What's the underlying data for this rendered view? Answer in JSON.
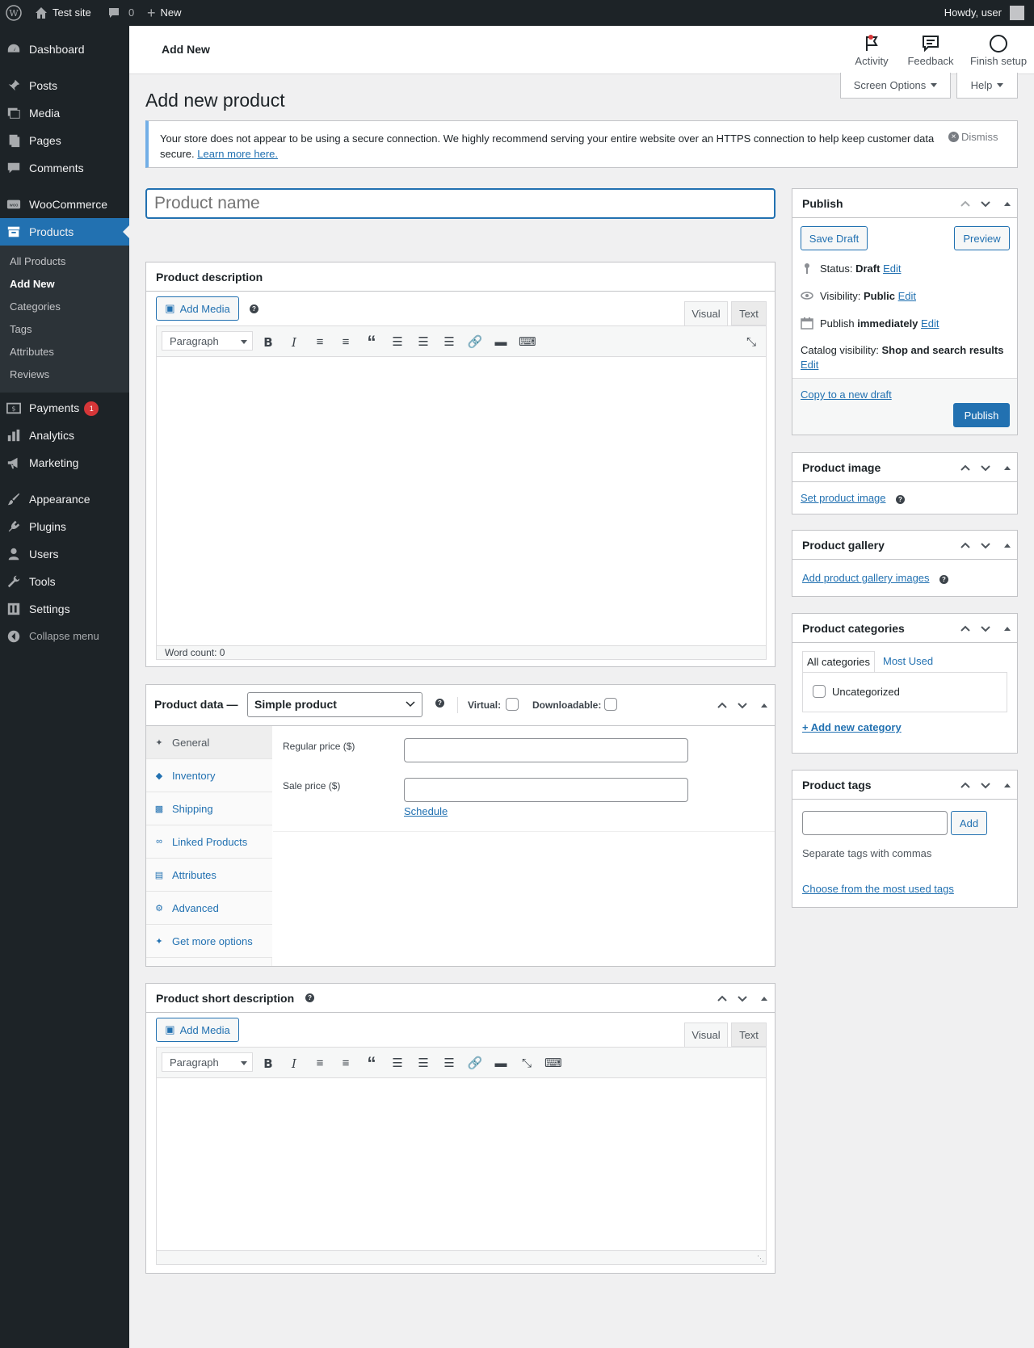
{
  "adminbar": {
    "site_name": "Test site",
    "comments_count": "0",
    "new_label": "New",
    "howdy": "Howdy, user"
  },
  "sidebar": {
    "items": [
      {
        "label": "Dashboard",
        "icon": "dashboard-icon"
      },
      {
        "label": "Posts",
        "icon": "pin-icon"
      },
      {
        "label": "Media",
        "icon": "media-icon"
      },
      {
        "label": "Pages",
        "icon": "pages-icon"
      },
      {
        "label": "Comments",
        "icon": "comment-icon"
      },
      {
        "label": "WooCommerce",
        "icon": "woo-icon"
      },
      {
        "label": "Products",
        "icon": "archive-icon"
      },
      {
        "label": "Payments",
        "icon": "payments-icon",
        "badge": "1"
      },
      {
        "label": "Analytics",
        "icon": "chart-icon"
      },
      {
        "label": "Marketing",
        "icon": "megaphone-icon"
      },
      {
        "label": "Appearance",
        "icon": "brush-icon"
      },
      {
        "label": "Plugins",
        "icon": "plugin-icon"
      },
      {
        "label": "Users",
        "icon": "users-icon"
      },
      {
        "label": "Tools",
        "icon": "wrench-icon"
      },
      {
        "label": "Settings",
        "icon": "settings-icon"
      },
      {
        "label": "Collapse menu",
        "icon": "collapse-icon"
      }
    ],
    "submenu": [
      "All Products",
      "Add New",
      "Categories",
      "Tags",
      "Attributes",
      "Reviews"
    ]
  },
  "header": {
    "title": "Add New",
    "activity": "Activity",
    "feedback": "Feedback",
    "finish_setup": "Finish setup"
  },
  "screen_options": "Screen Options",
  "help": "Help",
  "page_title": "Add new product",
  "notice": {
    "text": "Your store does not appear to be using a secure connection. We highly recommend serving your entire website over an HTTPS connection to help keep customer data secure.",
    "link": "Learn more here.",
    "dismiss": "Dismiss"
  },
  "product_name_placeholder": "Product name",
  "description": {
    "title": "Product description",
    "add_media": "Add Media",
    "tab_visual": "Visual",
    "tab_text": "Text",
    "format": "Paragraph",
    "word_count": "Word count: 0"
  },
  "product_data": {
    "title": "Product data —",
    "type": "Simple product",
    "virtual": "Virtual:",
    "downloadable": "Downloadable:",
    "tabs": [
      "General",
      "Inventory",
      "Shipping",
      "Linked Products",
      "Attributes",
      "Advanced",
      "Get more options"
    ],
    "regular_price": "Regular price ($)",
    "sale_price": "Sale price ($)",
    "schedule": "Schedule"
  },
  "short_description": {
    "title": "Product short description",
    "add_media": "Add Media",
    "tab_visual": "Visual",
    "tab_text": "Text",
    "format": "Paragraph"
  },
  "publish": {
    "title": "Publish",
    "save_draft": "Save Draft",
    "preview": "Preview",
    "status_label": "Status:",
    "status_value": "Draft",
    "visibility_label": "Visibility:",
    "visibility_value": "Public",
    "publish_label": "Publish",
    "publish_value": "immediately",
    "edit": "Edit",
    "catalog_label": "Catalog visibility:",
    "catalog_value": "Shop and search results",
    "copy_draft": "Copy to a new draft",
    "publish_button": "Publish"
  },
  "product_image": {
    "title": "Product image",
    "link": "Set product image"
  },
  "product_gallery": {
    "title": "Product gallery",
    "link": "Add product gallery images"
  },
  "product_categories": {
    "title": "Product categories",
    "tab_all": "All categories",
    "tab_most": "Most Used",
    "category": "Uncategorized",
    "add_new": "+ Add new category"
  },
  "product_tags": {
    "title": "Product tags",
    "add": "Add",
    "hint": "Separate tags with commas",
    "choose": "Choose from the most used tags"
  }
}
